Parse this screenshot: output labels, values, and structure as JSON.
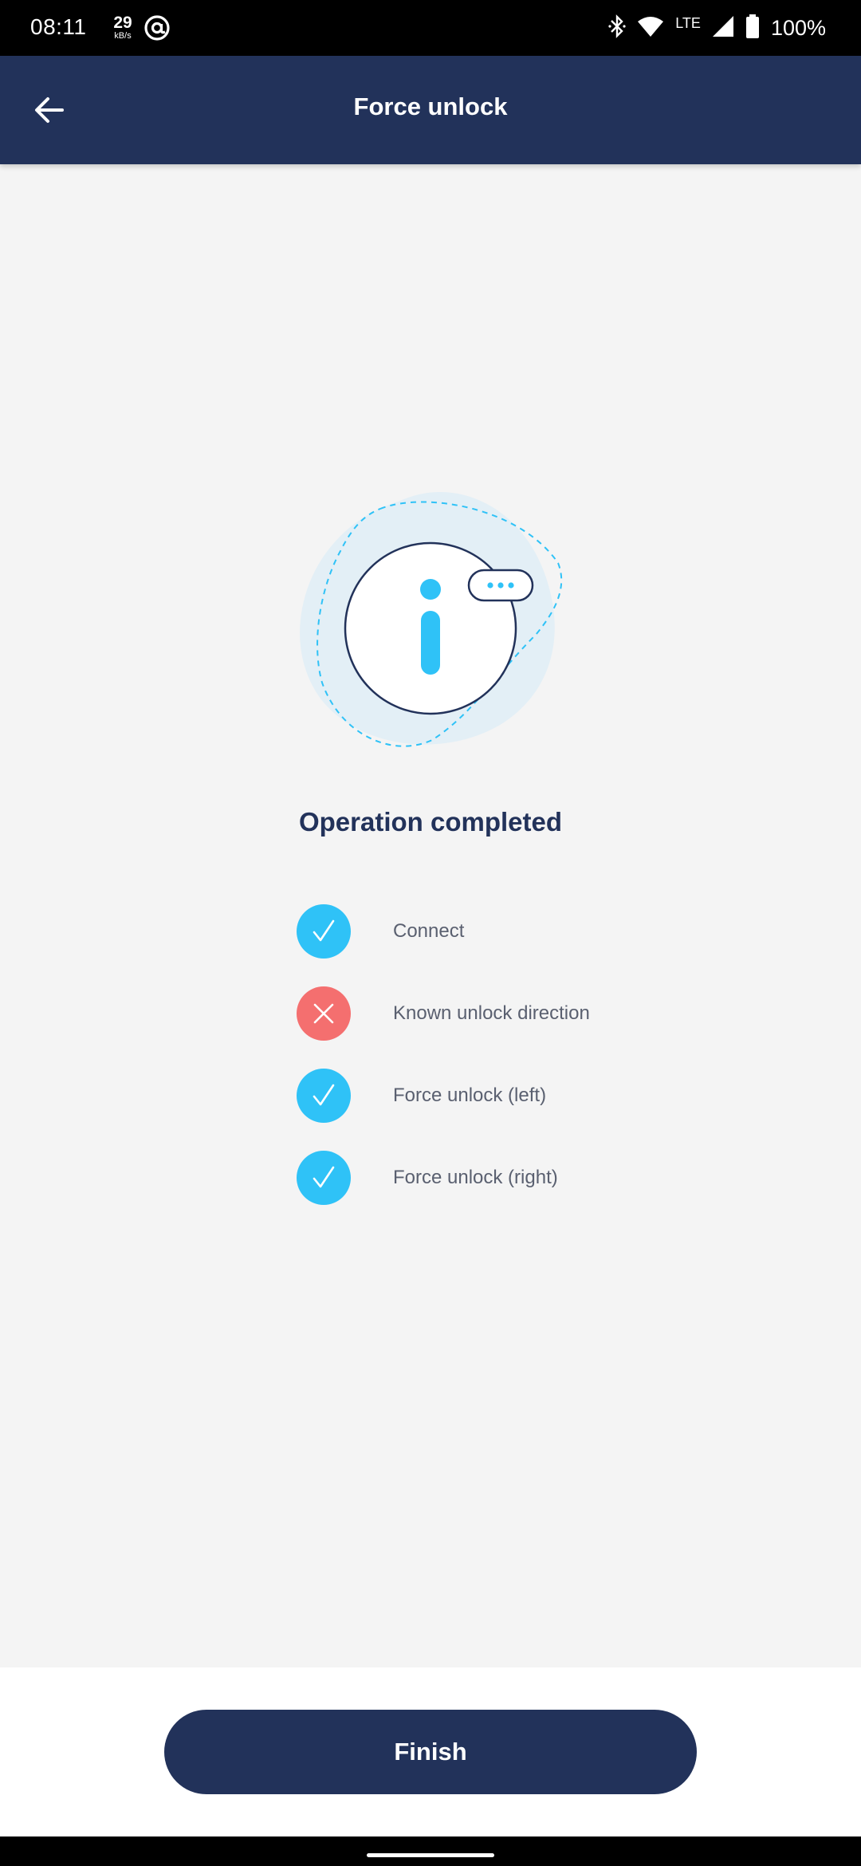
{
  "status_bar": {
    "time": "08:11",
    "speed_value": "29",
    "speed_unit": "kB/s",
    "network_type": "LTE",
    "battery": "100%",
    "icons": [
      "at-sign-icon",
      "bluetooth-icon",
      "wifi-icon",
      "cell-signal-icon",
      "battery-icon"
    ]
  },
  "app_bar": {
    "title": "Force unlock",
    "back_icon": "arrow-left-icon"
  },
  "result": {
    "illustration_icon": "info-icon",
    "title": "Operation completed",
    "steps": [
      {
        "label": "Connect",
        "status": "success",
        "icon": "check-icon"
      },
      {
        "label": "Known unlock direction",
        "status": "failed",
        "icon": "close-icon"
      },
      {
        "label": "Force unlock (left)",
        "status": "success",
        "icon": "check-icon"
      },
      {
        "label": "Force unlock (right)",
        "status": "success",
        "icon": "check-icon"
      }
    ]
  },
  "footer": {
    "finish_label": "Finish"
  },
  "colors": {
    "primary": "#22325a",
    "success": "#2fc2f7",
    "error": "#f46f6f",
    "background": "#f4f4f4"
  }
}
